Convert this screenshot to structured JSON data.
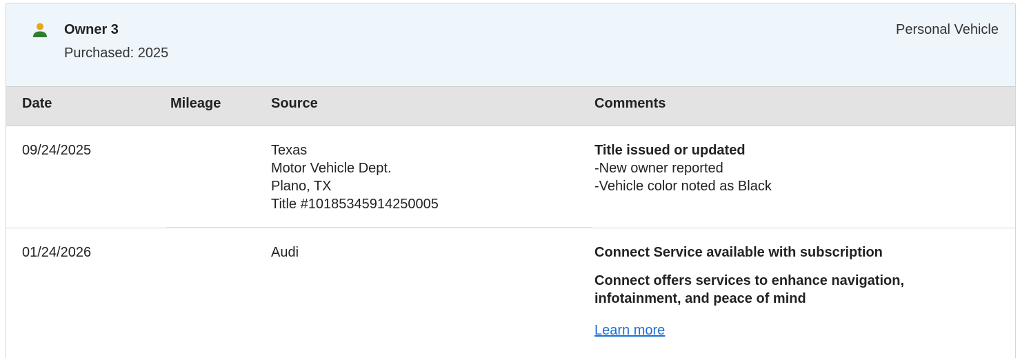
{
  "owner": {
    "title": "Owner 3",
    "purchased": "Purchased: 2025",
    "usage_type": "Personal Vehicle",
    "icon": "person-icon",
    "icon_colors": {
      "head": "#e6a817",
      "body": "#2e7d32"
    }
  },
  "table": {
    "headers": {
      "date": "Date",
      "mileage": "Mileage",
      "source": "Source",
      "comments": "Comments"
    },
    "rows": [
      {
        "date": "09/24/2025",
        "mileage": "",
        "source": [
          "Texas",
          "Motor Vehicle Dept.",
          "Plano, TX",
          "Title #10185345914250005"
        ],
        "comments": {
          "title": "Title issued or updated",
          "items": [
            "New owner reported",
            "Vehicle color noted as Black"
          ]
        }
      },
      {
        "date": "01/24/2026",
        "mileage": "",
        "source": [
          "Audi"
        ],
        "comments": {
          "paragraphs": [
            "Connect Service available with subscription",
            "Connect offers services to enhance navigation, infotainment, and peace of mind"
          ],
          "link": "Learn more"
        }
      }
    ]
  },
  "colors": {
    "header_bg": "#eef5fb",
    "table_head_bg": "#e3e3e3",
    "link": "#1a6fd6"
  }
}
